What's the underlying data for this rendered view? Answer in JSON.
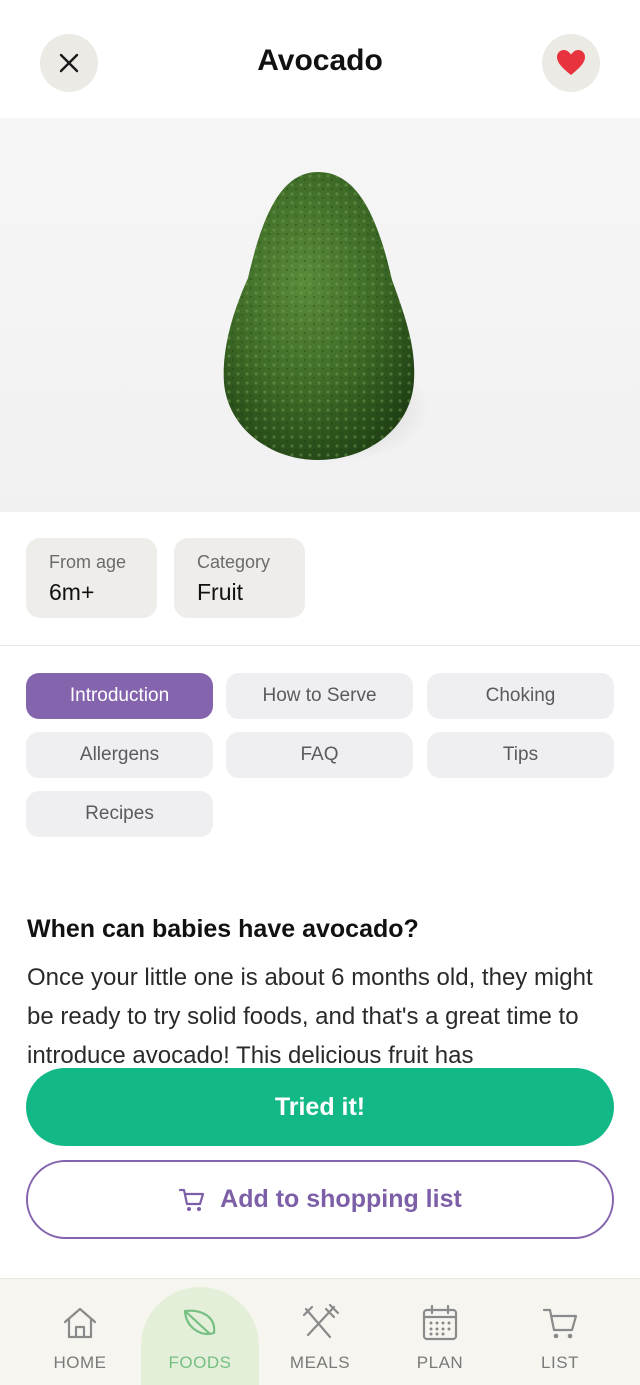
{
  "header": {
    "title": "Avocado",
    "close_icon": "close-icon",
    "favorite_icon": "heart-icon"
  },
  "meta": {
    "age_label": "From age",
    "age_value": "6m+",
    "category_label": "Category",
    "category_value": "Fruit"
  },
  "tabs": [
    {
      "label": "Introduction",
      "active": true
    },
    {
      "label": "How to Serve",
      "active": false
    },
    {
      "label": "Choking",
      "active": false
    },
    {
      "label": "Allergens",
      "active": false
    },
    {
      "label": "FAQ",
      "active": false
    },
    {
      "label": "Tips",
      "active": false
    },
    {
      "label": "Recipes",
      "active": false
    }
  ],
  "content": {
    "title": "When can babies have avocado?",
    "body": "Once your little one is about 6 months old, they might be ready to try solid foods, and that's a great time to introduce avocado! This delicious fruit has"
  },
  "actions": {
    "tried_label": "Tried it!",
    "shop_label": "Add to shopping list",
    "shop_icon": "cart-icon"
  },
  "nav": [
    {
      "label": "HOME",
      "icon": "home-icon",
      "active": false
    },
    {
      "label": "FOODS",
      "icon": "leaf-icon",
      "active": true
    },
    {
      "label": "MEALS",
      "icon": "utensils-icon",
      "active": false
    },
    {
      "label": "PLAN",
      "icon": "calendar-icon",
      "active": false
    },
    {
      "label": "LIST",
      "icon": "cart-icon",
      "active": false
    }
  ],
  "colors": {
    "accent_purple": "#8465ad",
    "primary_green": "#12b886",
    "favorite_red": "#e8333f",
    "nav_active_green": "#76bf82"
  }
}
